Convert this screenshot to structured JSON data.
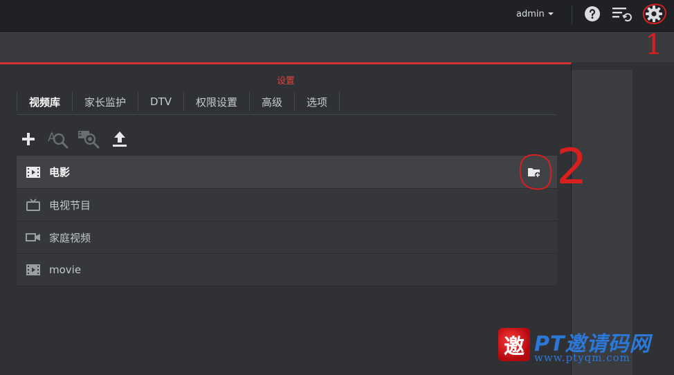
{
  "header": {
    "username": "admin",
    "icons": [
      "help-icon",
      "queue-refresh-icon",
      "settings-gear-icon"
    ]
  },
  "settings": {
    "title": "设置",
    "tabs": [
      {
        "label": "视频库",
        "active": true
      },
      {
        "label": "家长监护",
        "active": false
      },
      {
        "label": "DTV",
        "active": false
      },
      {
        "label": "权限设置",
        "active": false
      },
      {
        "label": "高级",
        "active": false
      },
      {
        "label": "选项",
        "active": false
      }
    ],
    "toolbar": [
      "add-icon",
      "scan-library-icon",
      "scan-all-icon",
      "upload-icon"
    ],
    "libraries": [
      {
        "label": "电影",
        "icon": "movie-icon",
        "selected": true
      },
      {
        "label": "电视节目",
        "icon": "tv-icon",
        "selected": false
      },
      {
        "label": "家庭视频",
        "icon": "video-camera-icon",
        "selected": false
      },
      {
        "label": "movie",
        "icon": "movie-icon",
        "selected": false
      }
    ]
  },
  "annotations": {
    "one": "1",
    "two": "2"
  },
  "watermark": {
    "logo_char": "邀",
    "title": "PT邀请码网",
    "url": "www.ptyqm.com"
  },
  "colors": {
    "accent_red": "#d23232",
    "title_red": "#e0453c",
    "watermark_blue": "#2b78d8"
  }
}
